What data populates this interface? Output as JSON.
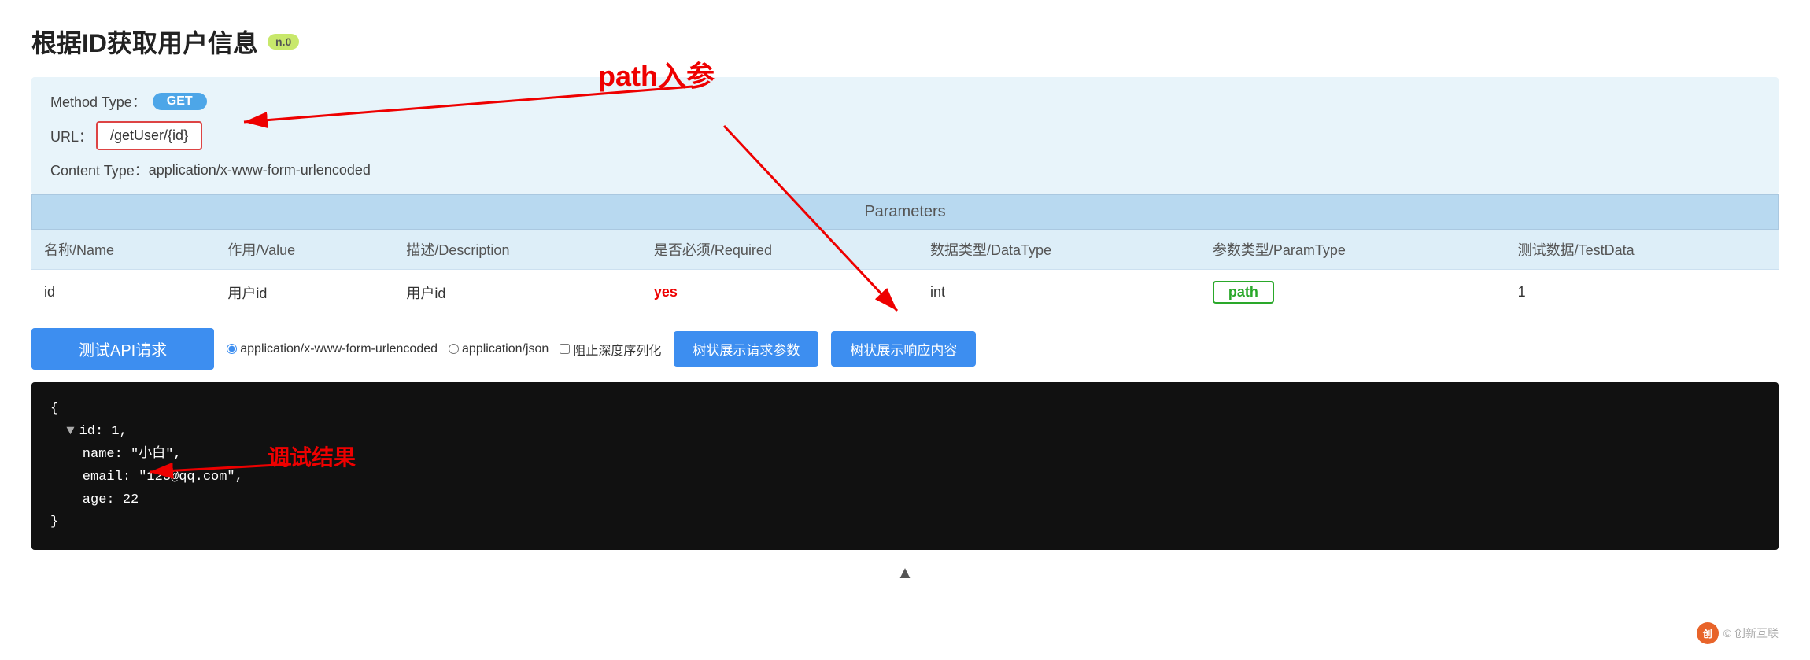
{
  "page": {
    "title": "根据ID获取用户信息",
    "version": "n.0"
  },
  "method": {
    "label": "Method Type：",
    "value": "GET"
  },
  "url": {
    "label": "URL：",
    "value": "/getUser/{id}"
  },
  "contentType": {
    "label": "Content Type：",
    "value": "application/x-www-form-urlencoded"
  },
  "parameters": {
    "header": "Parameters",
    "columns": [
      "名称/Name",
      "作用/Value",
      "描述/Description",
      "是否必须/Required",
      "数据类型/DataType",
      "参数类型/ParamType",
      "测试数据/TestData"
    ],
    "rows": [
      {
        "name": "id",
        "value": "用户id",
        "description": "用户id",
        "required": "yes",
        "dataType": "int",
        "paramType": "path",
        "testData": "1"
      }
    ]
  },
  "actionBar": {
    "testBtn": "测试API请求",
    "radioOptions": [
      "application/x-www-form-urlencoded",
      "application/json"
    ],
    "checkboxLabel": "阻止深度序列化",
    "treeRequestBtn": "树状展示请求参数",
    "treeResponseBtn": "树状展示响应内容"
  },
  "result": {
    "json": "{\n  id: 1,\n  name: \"小白\",\n  email: \"123@qq.com\",\n  age: 22\n}"
  },
  "annotations": {
    "pathLabel": "path入参",
    "debugLabel": "调试结果"
  },
  "footer": {
    "triangle": "▲",
    "watermark": "© 创新互联"
  }
}
